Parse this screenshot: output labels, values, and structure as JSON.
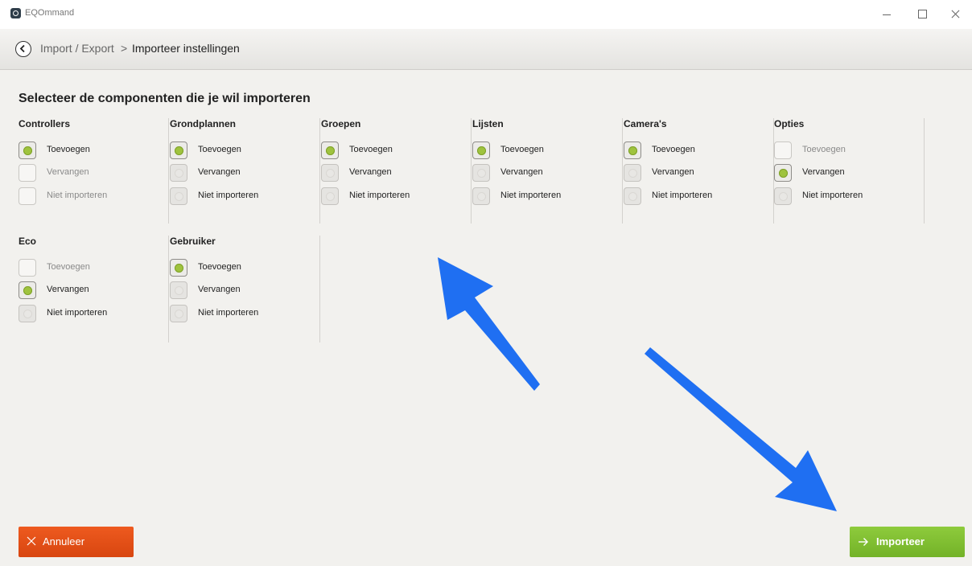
{
  "window": {
    "title": "EQOmmand"
  },
  "breadcrumb": {
    "parent": "Import / Export",
    "separator": ">",
    "current": "Importeer instellingen"
  },
  "page": {
    "title": "Selecteer de componenten die je wil importeren"
  },
  "columns": [
    {
      "title": "Controllers",
      "options": [
        {
          "label": "Toevoegen",
          "state": "selected"
        },
        {
          "label": "Vervangen",
          "state": "disabled"
        },
        {
          "label": "Niet importeren",
          "state": "disabled"
        }
      ]
    },
    {
      "title": "Grondplannen",
      "options": [
        {
          "label": "Toevoegen",
          "state": "selected"
        },
        {
          "label": "Vervangen",
          "state": "unselected"
        },
        {
          "label": "Niet importeren",
          "state": "unselected"
        }
      ]
    },
    {
      "title": "Groepen",
      "options": [
        {
          "label": "Toevoegen",
          "state": "selected"
        },
        {
          "label": "Vervangen",
          "state": "unselected"
        },
        {
          "label": "Niet importeren",
          "state": "unselected"
        }
      ]
    },
    {
      "title": "Lijsten",
      "options": [
        {
          "label": "Toevoegen",
          "state": "selected"
        },
        {
          "label": "Vervangen",
          "state": "unselected"
        },
        {
          "label": "Niet importeren",
          "state": "unselected"
        }
      ]
    },
    {
      "title": "Camera's",
      "options": [
        {
          "label": "Toevoegen",
          "state": "selected"
        },
        {
          "label": "Vervangen",
          "state": "unselected"
        },
        {
          "label": "Niet importeren",
          "state": "unselected"
        }
      ]
    },
    {
      "title": "Opties",
      "options": [
        {
          "label": "Toevoegen",
          "state": "disabled"
        },
        {
          "label": "Vervangen",
          "state": "selected"
        },
        {
          "label": "Niet importeren",
          "state": "unselected"
        }
      ]
    },
    {
      "title": "Eco",
      "options": [
        {
          "label": "Toevoegen",
          "state": "disabled"
        },
        {
          "label": "Vervangen",
          "state": "selected"
        },
        {
          "label": "Niet importeren",
          "state": "unselected"
        }
      ]
    },
    {
      "title": "Gebruiker",
      "options": [
        {
          "label": "Toevoegen",
          "state": "selected"
        },
        {
          "label": "Vervangen",
          "state": "unselected"
        },
        {
          "label": "Niet importeren",
          "state": "unselected"
        }
      ]
    }
  ],
  "actions": {
    "cancel_label": "Annuleer",
    "import_label": "Importeer"
  },
  "colors": {
    "cancel": "#e1501a",
    "import": "#7fbd32",
    "selected_dot": "#9fc33e",
    "annotation_arrow": "#1f6ff2"
  }
}
